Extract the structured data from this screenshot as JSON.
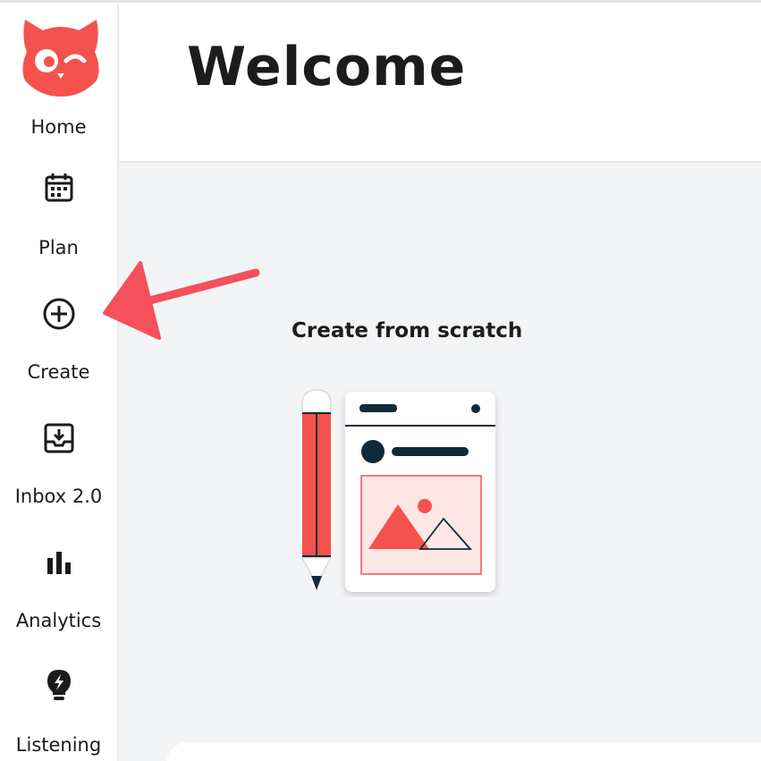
{
  "sidebar": {
    "logo_icon": "owl-logo",
    "items": [
      {
        "label": "Home",
        "icon": "owl-logo"
      },
      {
        "label": "Plan",
        "icon": "calendar-icon"
      },
      {
        "label": "Create",
        "icon": "plus-circle-icon"
      },
      {
        "label": "Inbox 2.0",
        "icon": "inbox-icon"
      },
      {
        "label": "Analytics",
        "icon": "bar-chart-icon"
      },
      {
        "label": "Listening",
        "icon": "lightbulb-icon"
      }
    ]
  },
  "header": {
    "title": "Welcome"
  },
  "main": {
    "create_card": {
      "title": "Create from scratch",
      "illustration_icon": "pencil-and-post-illustration"
    },
    "annotation": {
      "icon": "red-arrow-pointer"
    }
  },
  "colors": {
    "brand_red": "#f6524d",
    "dark_navy": "#0f2a3a",
    "sidebar_bg": "#ffffff",
    "content_bg": "#f3f4f6"
  }
}
